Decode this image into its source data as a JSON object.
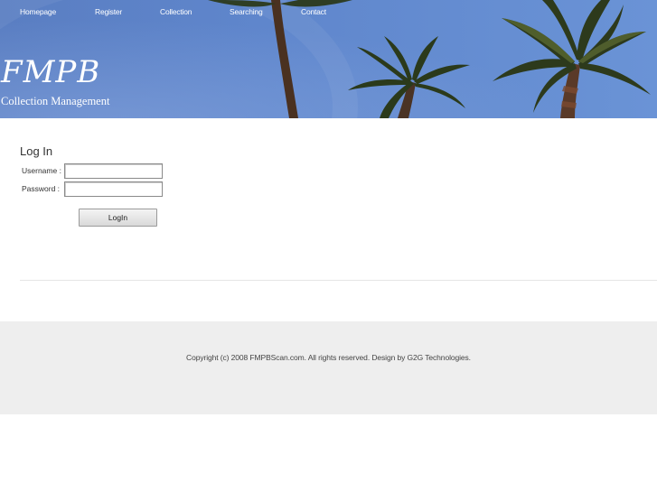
{
  "nav": {
    "items": [
      {
        "label": "Homepage"
      },
      {
        "label": "Register"
      },
      {
        "label": "Collection"
      },
      {
        "label": "Searching"
      },
      {
        "label": "Contact"
      }
    ]
  },
  "header": {
    "logo": "FMPB",
    "tagline": "Collection Management"
  },
  "login": {
    "title": "Log In",
    "username_label": "Username :",
    "password_label": "Password  :",
    "username_value": "",
    "password_value": "",
    "button_label": "LogIn"
  },
  "footer": {
    "copyright": "Copyright (c) 2008 FMPBScan.com. All rights reserved. Design by G2G Technologies."
  },
  "colors": {
    "header_sky": "#5f86cc",
    "footer_bg": "#eeeeee"
  }
}
